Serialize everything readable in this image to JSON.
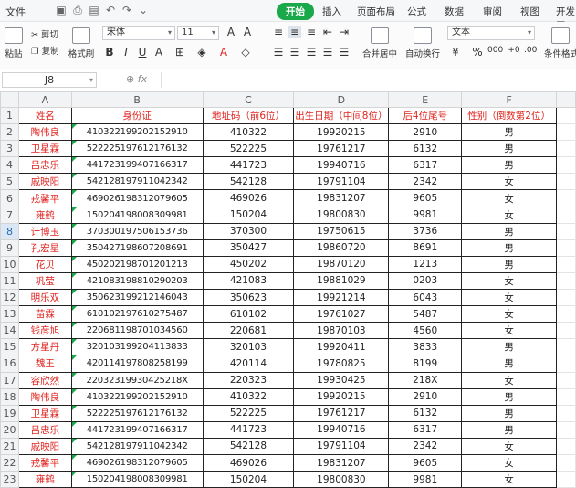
{
  "menubar": {
    "file_label": "文件",
    "tabs": [
      "开始",
      "插入",
      "页面布局",
      "公式",
      "数据",
      "审阅",
      "视图",
      "开发工"
    ]
  },
  "ribbon": {
    "paste": "粘贴",
    "cut": "剪切",
    "copy": "复制",
    "format_painter": "格式刷",
    "font_name": "宋体",
    "font_size": "11",
    "merge_center": "合并居中",
    "wrap_text": "自动换行",
    "number_format": "文本",
    "conditional_format": "条件格式"
  },
  "formula_bar": {
    "cell_ref": "J8",
    "fx_label": "fx",
    "content": ""
  },
  "columns": [
    "A",
    "B",
    "C",
    "D",
    "E",
    "F"
  ],
  "header_row": [
    "姓名",
    "身份证",
    "地址码（前6位）",
    "出生日期（中间8位）",
    "后4位尾号",
    "性别（倒数第2位）"
  ],
  "rows": [
    [
      "陶伟良",
      "410322199202152910",
      "410322",
      "19920215",
      "2910",
      "男"
    ],
    [
      "卫星霖",
      "522225197612176132",
      "522225",
      "19761217",
      "6132",
      "男"
    ],
    [
      "吕忠乐",
      "441723199407166317",
      "441723",
      "19940716",
      "6317",
      "男"
    ],
    [
      "戚映阳",
      "542128197911042342",
      "542128",
      "19791104",
      "2342",
      "女"
    ],
    [
      "戎馨平",
      "469026198312079605",
      "469026",
      "19831207",
      "9605",
      "女"
    ],
    [
      "雍鹤",
      "150204198008309981",
      "150204",
      "19800830",
      "9981",
      "女"
    ],
    [
      "计博玉",
      "370300197506153736",
      "370300",
      "19750615",
      "3736",
      "男"
    ],
    [
      "孔宏星",
      "350427198607208691",
      "350427",
      "19860720",
      "8691",
      "男"
    ],
    [
      "花贝",
      "450202198701201213",
      "450202",
      "19870120",
      "1213",
      "男"
    ],
    [
      "巩莹",
      "421083198810290203",
      "421083",
      "19881029",
      "0203",
      "女"
    ],
    [
      "明乐双",
      "350623199212146043",
      "350623",
      "19921214",
      "6043",
      "女"
    ],
    [
      "苗霖",
      "610102197610275487",
      "610102",
      "19761027",
      "5487",
      "女"
    ],
    [
      "钱彦旭",
      "220681198701034560",
      "220681",
      "19870103",
      "4560",
      "女"
    ],
    [
      "方星丹",
      "320103199204113833",
      "320103",
      "19920411",
      "3833",
      "男"
    ],
    [
      "魏王",
      "420114197808258199",
      "420114",
      "19780825",
      "8199",
      "男"
    ],
    [
      "容欣然",
      "22032319930425218X",
      "220323",
      "19930425",
      "218X",
      "女"
    ],
    [
      "陶伟良",
      "410322199202152910",
      "410322",
      "19920215",
      "2910",
      "男"
    ],
    [
      "卫星霖",
      "522225197612176132",
      "522225",
      "19761217",
      "6132",
      "男"
    ],
    [
      "吕忠乐",
      "441723199407166317",
      "441723",
      "19940716",
      "6317",
      "男"
    ],
    [
      "戚映阳",
      "542128197911042342",
      "542128",
      "19791104",
      "2342",
      "女"
    ],
    [
      "戎馨平",
      "469026198312079605",
      "469026",
      "19831207",
      "9605",
      "女"
    ],
    [
      "雍鹤",
      "150204198008309981",
      "150204",
      "19800830",
      "9981",
      "女"
    ]
  ],
  "selected_row": "8",
  "colors": {
    "accent": "#1aa94a",
    "header_text": "#e0241f"
  }
}
